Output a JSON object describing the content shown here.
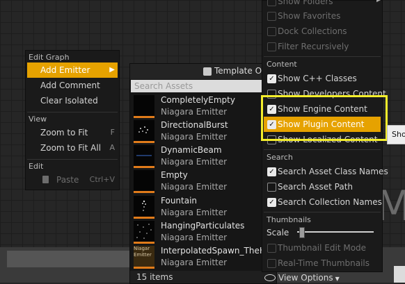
{
  "context_menu": {
    "edit_graph_header": "Edit Graph",
    "add_emitter": "Add Emitter",
    "add_comment": "Add Comment",
    "clear_isolated": "Clear Isolated",
    "view_header": "View",
    "zoom_to_fit": "Zoom to Fit",
    "zoom_to_fit_shortcut": "F",
    "zoom_to_fit_all": "Zoom to Fit All",
    "zoom_to_fit_all_shortcut": "A",
    "edit_header": "Edit",
    "paste": "Paste",
    "paste_shortcut": "Ctrl+V"
  },
  "picker": {
    "template_only_label": "Template Only",
    "search_placeholder": "Search Assets",
    "assets": [
      {
        "name": "CompletelyEmpty",
        "type": "Niagara Emitter"
      },
      {
        "name": "DirectionalBurst",
        "type": "Niagara Emitter"
      },
      {
        "name": "DynamicBeam",
        "type": "Niagara Emitter"
      },
      {
        "name": "Empty",
        "type": "Niagara Emitter"
      },
      {
        "name": "Fountain",
        "type": "Niagara Emitter"
      },
      {
        "name": "HangingParticulates",
        "type": "Niagara Emitter"
      },
      {
        "name": "InterpolatedSpawn_TheHyp",
        "type": "Niagara Emitter",
        "thumb_text": "Niagar Emitter"
      }
    ],
    "item_count": "15 items",
    "view_options": "View Options"
  },
  "view_options": {
    "show_folders": "Show Folders",
    "show_favorites": "Show Favorites",
    "dock_collections": "Dock Collections",
    "filter_recursively": "Filter Recursively",
    "content_header": "Content",
    "show_cpp_classes": "Show C++ Classes",
    "show_developers_content": "Show Developers Content",
    "show_engine_content": "Show Engine Content",
    "show_plugin_content": "Show Plugin Content",
    "show_localized_content": "Show Localized Content",
    "search_header": "Search",
    "search_asset_class_names": "Search Asset Class Names",
    "search_asset_path": "Search Asset Path",
    "search_collection_names": "Search Collection Names",
    "thumbnails_header": "Thumbnails",
    "scale_label": "Scale",
    "scale_value": 0.1,
    "thumbnail_edit_mode": "Thumbnail Edit Mode",
    "real_time_thumbnails": "Real-Time Thumbnails"
  },
  "tooltip_text": "Sho",
  "background_letter": "M",
  "colors": {
    "accent": "#e6a200",
    "highlight_box": "#f4ee2b",
    "emitter_underline": "#e07b1a"
  }
}
